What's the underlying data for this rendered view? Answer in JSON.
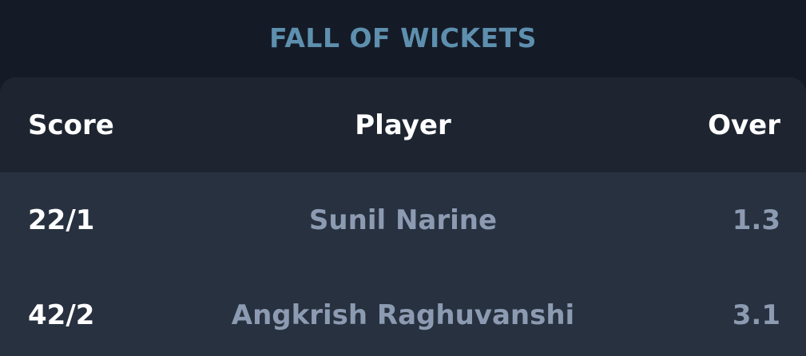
{
  "title": "FALL OF WICKETS",
  "table": {
    "headers": {
      "score": "Score",
      "player": "Player",
      "over": "Over"
    },
    "rows": [
      {
        "score": "22/1",
        "player": "Sunil Narine",
        "over": "1.3"
      },
      {
        "score": "42/2",
        "player": "Angkrish Raghuvanshi",
        "over": "3.1"
      }
    ]
  },
  "colors": {
    "background": "#141b27",
    "title": "#5e8fae",
    "header_bg": "#1e2531",
    "row_bg": "#283140",
    "muted_text": "#8c9bb1"
  }
}
